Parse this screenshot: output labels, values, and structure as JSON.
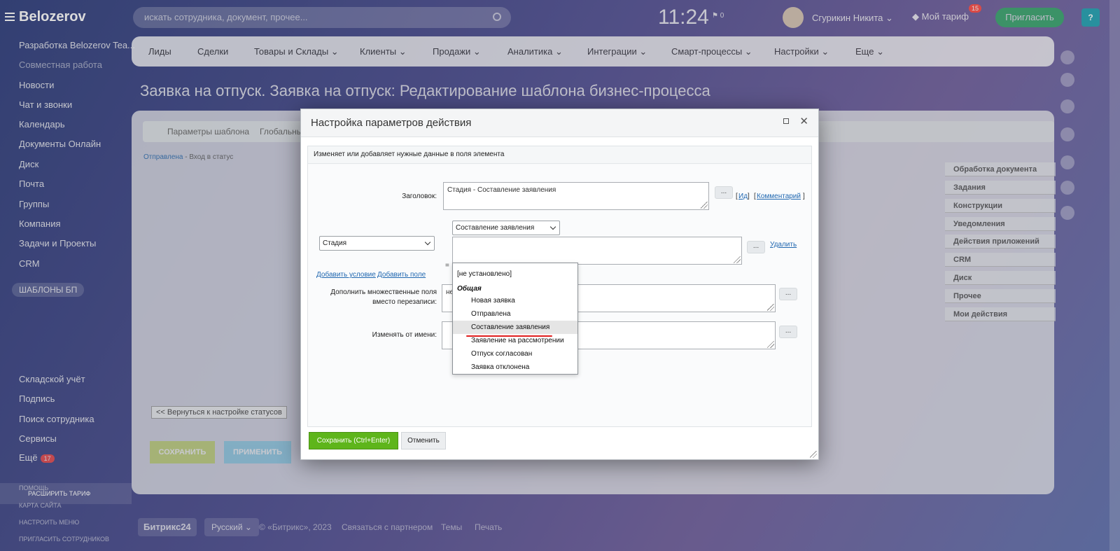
{
  "header": {
    "logo": "Belozerov",
    "search_placeholder": "искать сотрудника, документ, прочее...",
    "time": "11:24",
    "flag_count": "0",
    "user_name": "Сгурикин Никита",
    "tariff": "Мой тариф",
    "tariff_badge": "15",
    "invite": "Пригласить",
    "help": "?"
  },
  "sidebar": {
    "items": [
      "Разработка Belozerov Tea...",
      "Совместная работа",
      "Новости",
      "Чат и звонки",
      "Календарь",
      "Документы Онлайн",
      "Диск",
      "Почта",
      "Группы",
      "Компания",
      "Задачи и Проекты",
      "CRM",
      "ШАБЛОНЫ БП",
      "Складской учёт",
      "Подпись",
      "Поиск сотрудника",
      "Сервисы",
      "Ещё"
    ],
    "more_badge": "17",
    "small_links": [
      "ПОМОЩЬ",
      "КАРТА САЙТА",
      "НАСТРОИТЬ МЕНЮ",
      "ПРИГЛАСИТЬ СОТРУДНИКОВ"
    ],
    "expand": "РАСШИРИТЬ ТАРИФ"
  },
  "nav": {
    "items": [
      "Лиды",
      "Сделки",
      "Товары и Склады",
      "Клиенты",
      "Продажи",
      "Аналитика",
      "Интеграции",
      "Смарт-процессы",
      "Настройки",
      "Еще"
    ]
  },
  "page": {
    "title": "Заявка на отпуск. Заявка на отпуск: Редактирование шаблона бизнес-процесса",
    "tabs": [
      "Параметры шаблона",
      "Глобальны"
    ],
    "crumb_link": "Отправлена",
    "crumb_text": " - Вход в статус",
    "right_groups": [
      "Обработка документа",
      "Задания",
      "Конструкции",
      "Уведомления",
      "Действия приложений",
      "CRM",
      "Диск",
      "Прочее",
      "Мои действия"
    ],
    "back_btn": "<< Вернуться к настройке статусов",
    "save": "СОХРАНИТЬ",
    "apply": "ПРИМЕНИТЬ"
  },
  "footer": {
    "logo": "Битрикс24",
    "lang": "Русский",
    "copyright": "© «Битрикс», 2023",
    "partner": "Связаться с партнером",
    "themes": "Темы",
    "print": "Печать"
  },
  "dialog": {
    "title": "Настройка параметров действия",
    "description": "Изменяет или добавляет нужные данные в поля элемента",
    "title_label": "Заголовок:",
    "title_value": "Стадия - Составление заявления",
    "dots": "...",
    "link_id": "Ид",
    "link_comment": "Комментарий",
    "field_select": "Стадия",
    "equals": "=",
    "value_select": "Составление заявления",
    "delete_link": "Удалить",
    "add_condition": "Добавить условие",
    "add_field": "Добавить поле",
    "append_label": "Дополнить множественные поля вместо перезаписи:",
    "append_value": "не",
    "modify_by_label": "Изменять от имени:",
    "dropdown": {
      "not_set": "[не установлено]",
      "group": "Общая",
      "options": [
        "Новая заявка",
        "Отправлена",
        "Составление заявления",
        "Заявление на рассмотрении",
        "Отпуск согласован",
        "Заявка отклонена"
      ],
      "selected": "Составление заявления"
    },
    "save_btn": "Сохранить (Ctrl+Enter)",
    "cancel_btn": "Отменить"
  },
  "colors": {
    "save_green": "#5eb51b",
    "link_blue": "#2067b0",
    "annotation_red": "#e01e1e"
  }
}
